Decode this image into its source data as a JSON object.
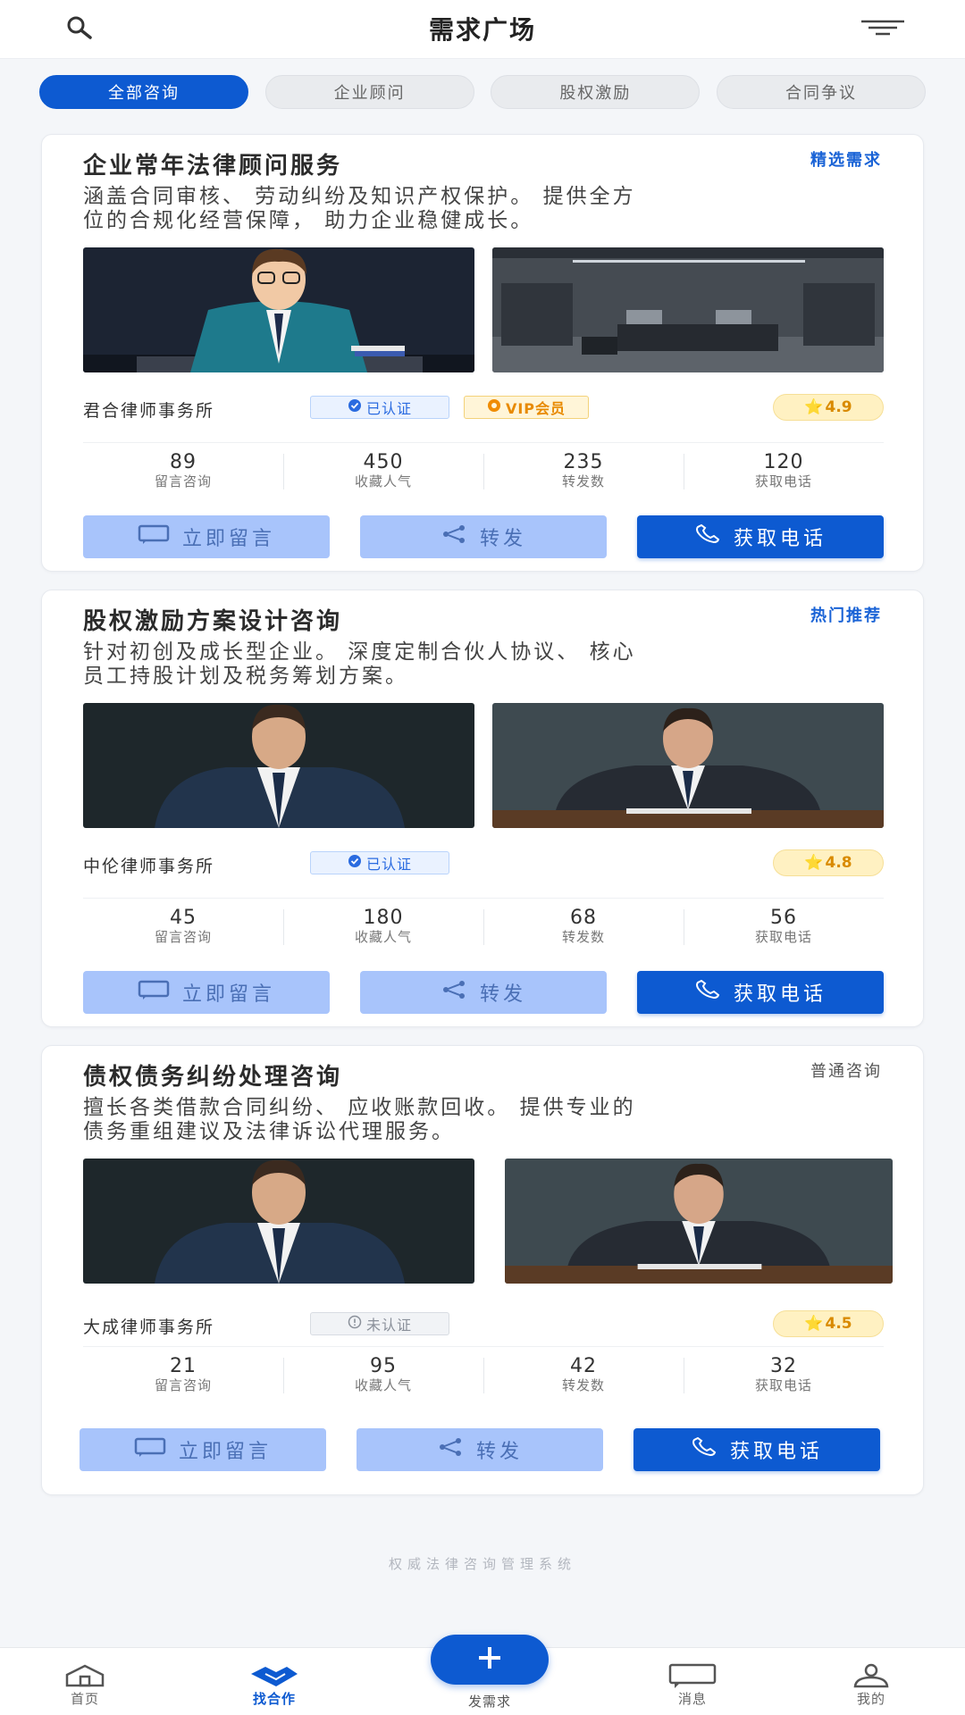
{
  "header": {
    "title": "需求广场",
    "search_icon": "search-icon",
    "filter_icon": "filter-icon"
  },
  "tabs": [
    {
      "label": "全部咨询",
      "active": true
    },
    {
      "label": "企业顾问",
      "active": false
    },
    {
      "label": "股权激励",
      "active": false
    },
    {
      "label": "合同争议",
      "active": false
    }
  ],
  "cards": [
    {
      "title": "企业常年法律顾问服务",
      "tag": "精选需求",
      "desc_line1": "涵盖合同审核、 劳动纠纷及知识产权保护。 提供全方",
      "desc_line2": "位的合规化经营保障， 助力企业稳健成长。",
      "firm": "君合律师事务所",
      "verified": "已认证",
      "vip": "VIP会员",
      "rating": "4.9",
      "stats": [
        {
          "num": "89",
          "label": "留言咨询"
        },
        {
          "num": "450",
          "label": "收藏人气"
        },
        {
          "num": "235",
          "label": "转发数"
        },
        {
          "num": "120",
          "label": "获取电话"
        }
      ],
      "btn_message": "立即留言",
      "btn_share": "转发",
      "btn_call": "获取电话"
    },
    {
      "title": "股权激励方案设计咨询",
      "tag": "热门推荐",
      "desc_line1": "针对初创及成长型企业。 深度定制合伙人协议、 核心",
      "desc_line2": "员工持股计划及税务筹划方案。",
      "firm": "中伦律师事务所",
      "verified": "已认证",
      "rating": "4.8",
      "stats": [
        {
          "num": "45",
          "label": "留言咨询"
        },
        {
          "num": "180",
          "label": "收藏人气"
        },
        {
          "num": "68",
          "label": "转发数"
        },
        {
          "num": "56",
          "label": "获取电话"
        }
      ],
      "btn_message": "立即留言",
      "btn_share": "转发",
      "btn_call": "获取电话"
    },
    {
      "title": "债权债务纠纷处理咨询",
      "tag": "普通咨询",
      "desc_line1": "擅长各类借款合同纠纷、 应收账款回收。 提供专业的",
      "desc_line2": "债务重组建议及法律诉讼代理服务。",
      "firm": "大成律师事务所",
      "unverified": "未认证",
      "rating": "4.5",
      "stats": [
        {
          "num": "21",
          "label": "留言咨询"
        },
        {
          "num": "95",
          "label": "收藏人气"
        },
        {
          "num": "42",
          "label": "转发数"
        },
        {
          "num": "32",
          "label": "获取电话"
        }
      ],
      "btn_message": "立即留言",
      "btn_share": "转发",
      "btn_call": "获取电话"
    }
  ],
  "footer_note": "权威法律咨询管理系统",
  "nav": {
    "home": "首页",
    "partner": "找合作",
    "publish": "发需求",
    "messages": "消息",
    "mine": "我的"
  },
  "colors": {
    "primary": "#0d5ad1",
    "light_button": "#a8c4fb",
    "rating_bg": "#fff1c2"
  }
}
